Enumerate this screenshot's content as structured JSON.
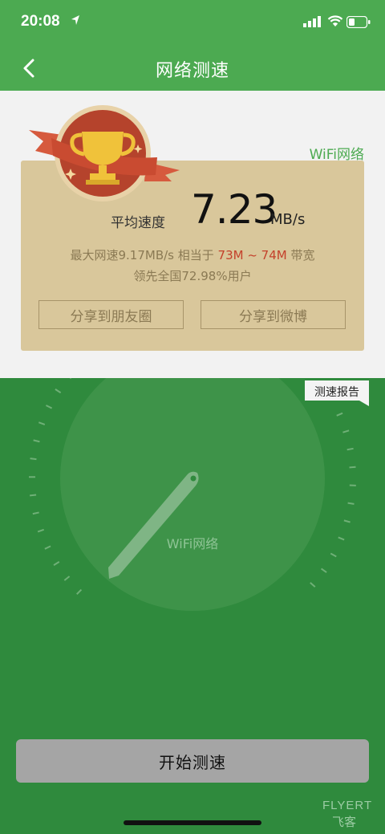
{
  "status_bar": {
    "time": "20:08"
  },
  "nav": {
    "title": "网络测速"
  },
  "network_label": "WiFi网络",
  "result": {
    "avg_label": "平均速度",
    "speed": "7.23",
    "unit": "MB/s",
    "max_prefix": "最大网速9.17MB/s 相当于 ",
    "bandwidth": "73M ~ 74M",
    "bandwidth_suffix": " 带宽",
    "rank": "领先全国72.98%用户"
  },
  "share": {
    "moments": "分享到朋友圈",
    "weibo": "分享到微博"
  },
  "gauge": {
    "network_label": "WiFi网络"
  },
  "report_label": "测速报告",
  "start_button": "开始测速",
  "watermark": {
    "line1": "FLYERT",
    "line2": "飞客"
  },
  "colors": {
    "green_header": "#4caa51",
    "green_body": "#2f8a3d",
    "card": "#d9c79b",
    "highlight": "#c4412b"
  }
}
